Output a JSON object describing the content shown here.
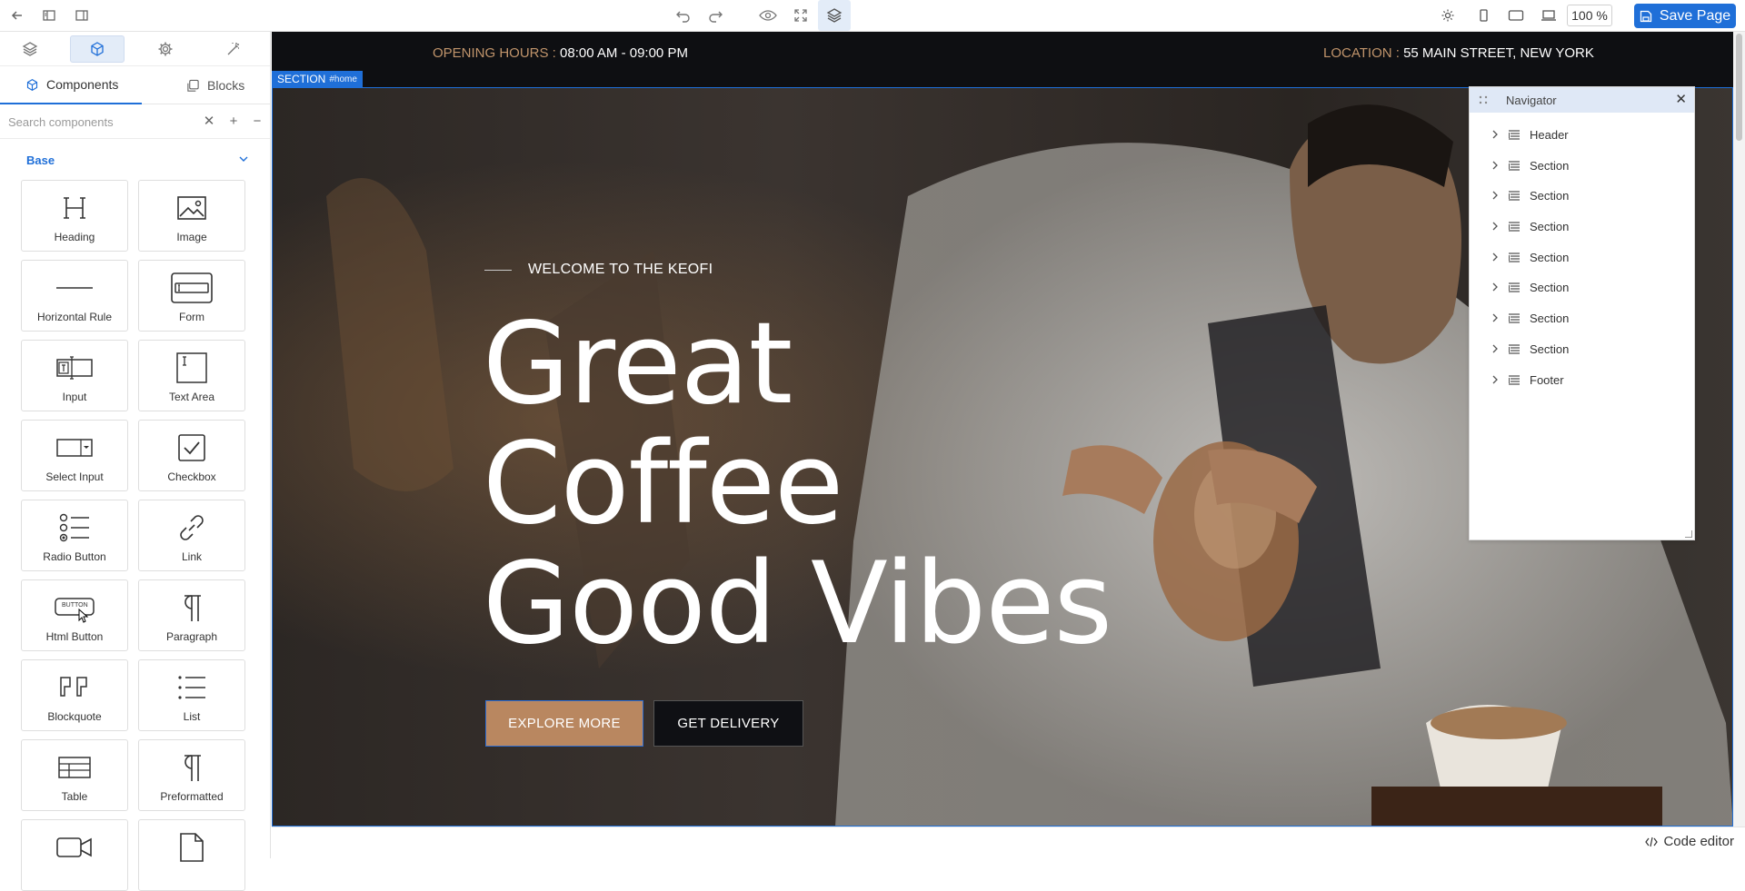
{
  "toolbar": {
    "zoom": "100 %",
    "save_label": "Save Page"
  },
  "left_panel": {
    "tabs": [
      "Layers",
      "Components",
      "Settings",
      "Style"
    ],
    "subtabs": {
      "components": "Components",
      "blocks": "Blocks"
    },
    "search": {
      "placeholder": "Search components",
      "value": ""
    },
    "category": "Base",
    "components": [
      {
        "label": "Heading",
        "icon": "heading-icon"
      },
      {
        "label": "Image",
        "icon": "image-icon"
      },
      {
        "label": "Horizontal Rule",
        "icon": "hr-icon"
      },
      {
        "label": "Form",
        "icon": "form-icon"
      },
      {
        "label": "Input",
        "icon": "input-icon"
      },
      {
        "label": "Text Area",
        "icon": "textarea-icon"
      },
      {
        "label": "Select Input",
        "icon": "select-icon"
      },
      {
        "label": "Checkbox",
        "icon": "checkbox-icon"
      },
      {
        "label": "Radio Button",
        "icon": "radio-icon"
      },
      {
        "label": "Link",
        "icon": "link-icon"
      },
      {
        "label": "Html Button",
        "icon": "button-icon"
      },
      {
        "label": "Paragraph",
        "icon": "paragraph-icon"
      },
      {
        "label": "Blockquote",
        "icon": "blockquote-icon"
      },
      {
        "label": "List",
        "icon": "list-icon"
      },
      {
        "label": "Table",
        "icon": "table-icon"
      },
      {
        "label": "Preformatted",
        "icon": "preformatted-icon"
      },
      {
        "label": "",
        "icon": "video-icon"
      },
      {
        "label": "",
        "icon": "file-icon"
      }
    ],
    "button_icon_text": "BUTTON"
  },
  "page": {
    "info_left_key": "OPENING HOURS :",
    "info_left_val": " 08:00 AM - 09:00 PM",
    "info_right_key": "LOCATION :",
    "info_right_val": " 55 MAIN STREET, NEW YORK",
    "section_tag": "SECTION",
    "section_id": "#home",
    "welcome": "WELCOME TO THE KEOFI",
    "headline": [
      "Great",
      "Coffee",
      "Good Vibes"
    ],
    "btn_explore": "EXPLORE MORE",
    "btn_delivery": "GET DELIVERY"
  },
  "navigator": {
    "title": "Navigator",
    "items": [
      "Header",
      "Section",
      "Section",
      "Section",
      "Section",
      "Section",
      "Section",
      "Section",
      "Footer"
    ]
  },
  "bottom": {
    "code_editor": "Code editor"
  },
  "colors": {
    "accent": "#1f6fd8",
    "brand": "#b98760",
    "dark": "#0e0f12"
  }
}
